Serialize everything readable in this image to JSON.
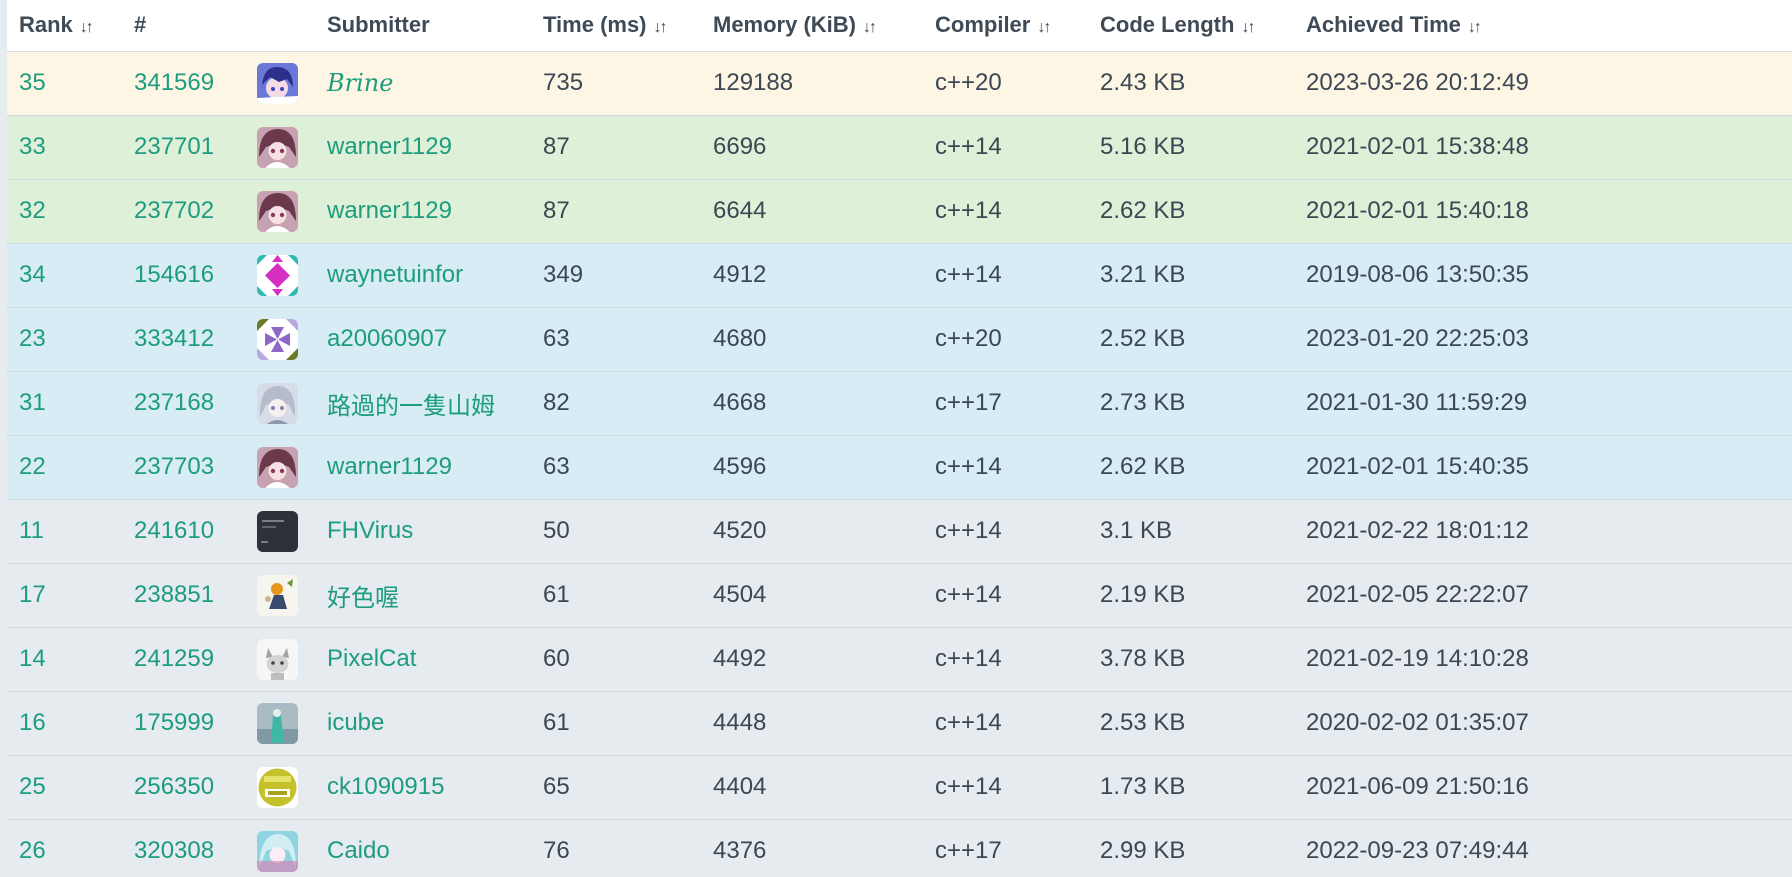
{
  "table": {
    "headers": {
      "rank": "Rank",
      "id": "#",
      "submitter": "Submitter",
      "time": "Time (ms)",
      "memory": "Memory (KiB)",
      "compiler": "Compiler",
      "code_length": "Code Length",
      "achieved": "Achieved Time"
    },
    "sort_glyph": "↓↑",
    "rows": [
      {
        "rank": "35",
        "id": "341569",
        "submitter": "Brine",
        "time": "735",
        "memory": "129188",
        "compiler": "c++20",
        "code_length": "2.43 KB",
        "achieved": "2023-03-26 20:12:49",
        "avatar": "anime-girl-blue-hair-icon",
        "highlight": "self"
      },
      {
        "rank": "33",
        "id": "237701",
        "submitter": "warner1129",
        "time": "87",
        "memory": "6696",
        "compiler": "c++14",
        "code_length": "5.16 KB",
        "achieved": "2021-02-01 15:38:48",
        "avatar": "anime-girl-brown-hair-icon",
        "highlight": "success"
      },
      {
        "rank": "32",
        "id": "237702",
        "submitter": "warner1129",
        "time": "87",
        "memory": "6644",
        "compiler": "c++14",
        "code_length": "2.62 KB",
        "achieved": "2021-02-01 15:40:18",
        "avatar": "anime-girl-brown-hair-icon",
        "highlight": "success"
      },
      {
        "rank": "34",
        "id": "154616",
        "submitter": "waynetuinfor",
        "time": "349",
        "memory": "4912",
        "compiler": "c++14",
        "code_length": "3.21 KB",
        "achieved": "2019-08-06 13:50:35",
        "avatar": "identicon-magenta-icon",
        "highlight": "info"
      },
      {
        "rank": "23",
        "id": "333412",
        "submitter": "a20060907",
        "time": "63",
        "memory": "4680",
        "compiler": "c++20",
        "code_length": "2.52 KB",
        "achieved": "2023-01-20 22:25:03",
        "avatar": "identicon-purple-olive-icon",
        "highlight": "info"
      },
      {
        "rank": "31",
        "id": "237168",
        "submitter": "路過的一隻山姆",
        "time": "82",
        "memory": "4668",
        "compiler": "c++17",
        "code_length": "2.73 KB",
        "achieved": "2021-01-30 11:59:29",
        "avatar": "anime-girl-silver-hair-icon",
        "highlight": "info"
      },
      {
        "rank": "22",
        "id": "237703",
        "submitter": "warner1129",
        "time": "63",
        "memory": "4596",
        "compiler": "c++14",
        "code_length": "2.62 KB",
        "achieved": "2021-02-01 15:40:35",
        "avatar": "anime-girl-brown-hair-icon",
        "highlight": "info"
      },
      {
        "rank": "11",
        "id": "241610",
        "submitter": "FHVirus",
        "time": "50",
        "memory": "4520",
        "compiler": "c++14",
        "code_length": "3.1 KB",
        "achieved": "2021-02-22 18:01:12",
        "avatar": "dark-terminal-icon",
        "highlight": "plain"
      },
      {
        "rank": "17",
        "id": "238851",
        "submitter": "好色喔",
        "time": "61",
        "memory": "4504",
        "compiler": "c++14",
        "code_length": "2.19 KB",
        "achieved": "2021-02-05 22:22:07",
        "avatar": "cartoon-character-icon",
        "highlight": "plain"
      },
      {
        "rank": "14",
        "id": "241259",
        "submitter": "PixelCat",
        "time": "60",
        "memory": "4492",
        "compiler": "c++14",
        "code_length": "3.78 KB",
        "achieved": "2021-02-19 14:10:28",
        "avatar": "white-cat-icon",
        "highlight": "plain"
      },
      {
        "rank": "16",
        "id": "175999",
        "submitter": "icube",
        "time": "61",
        "memory": "4448",
        "compiler": "c++14",
        "code_length": "2.53 KB",
        "achieved": "2020-02-02 01:35:07",
        "avatar": "teal-figure-icon",
        "highlight": "plain"
      },
      {
        "rank": "25",
        "id": "256350",
        "submitter": "ck1090915",
        "time": "65",
        "memory": "4404",
        "compiler": "c++14",
        "code_length": "1.73 KB",
        "achieved": "2021-06-09 21:50:16",
        "avatar": "yellow-badge-icon",
        "highlight": "plain"
      },
      {
        "rank": "26",
        "id": "320308",
        "submitter": "Caido",
        "time": "76",
        "memory": "4376",
        "compiler": "c++17",
        "code_length": "2.99 KB",
        "achieved": "2022-09-23 07:49:44",
        "avatar": "anime-girl-teal-hair-icon",
        "highlight": "plain"
      }
    ]
  },
  "colors": {
    "link": "#1d9c7e",
    "text": "#3b4752",
    "row_self": "#fdf6e4",
    "row_success": "#dff0d8",
    "row_info": "#d8ecf6",
    "row_plain": "#e6ebef"
  }
}
